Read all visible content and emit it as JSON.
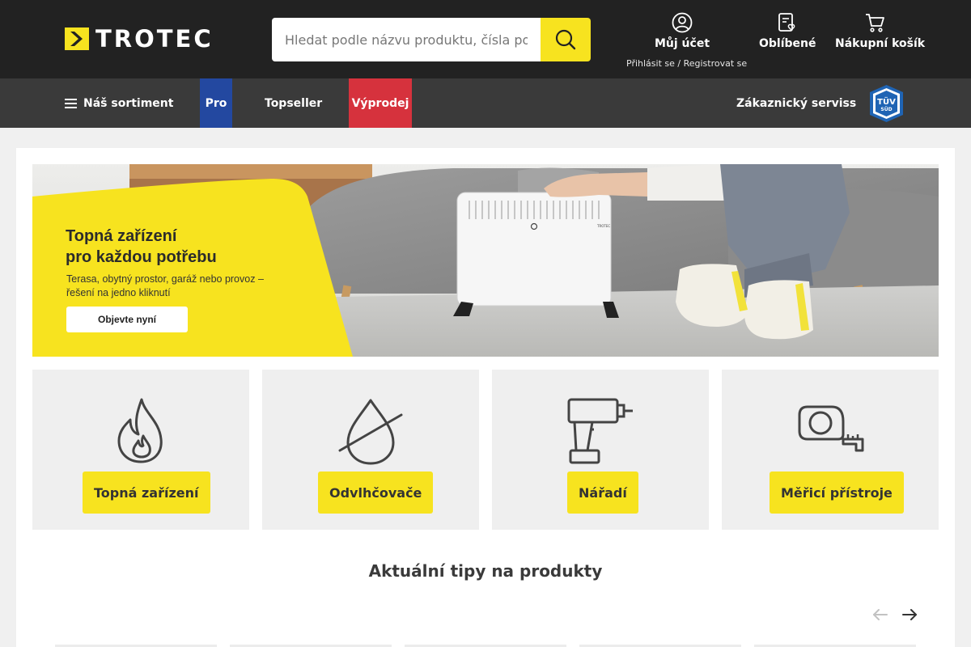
{
  "header": {
    "logo_text": "TROTEC",
    "search_placeholder": "Hledat podle názvu produktu, čísla položky",
    "account_label": "Můj účet",
    "account_sub": "Přihlásit se / Registrovat se",
    "favorites_label": "Oblíbené",
    "cart_label": "Nákupní košík"
  },
  "nav": {
    "assortment": "Náš sortiment",
    "pro": "Pro",
    "topseller": "Topseller",
    "sale": "Výprodej",
    "service": "Zákaznický serviss",
    "tuv_text": "TÜV",
    "tuv_sub": "SÜD",
    "colors": {
      "pro": "#2348a0",
      "sale": "#d6323d"
    }
  },
  "banner": {
    "title_line1": "Topná zařízení",
    "title_line2": "pro každou potřebu",
    "subtitle_line1": "Terasa, obytný prostor, garáž nebo provoz –",
    "subtitle_line2": "řešení na jedno kliknutí",
    "button": "Objevte nyní",
    "heater_brand": "TROTEC"
  },
  "categories": [
    {
      "label": "Topná zařízení",
      "icon": "flame-icon"
    },
    {
      "label": "Odvlhčovače",
      "icon": "drop-crossed-icon"
    },
    {
      "label": "Nářadí",
      "icon": "drill-icon"
    },
    {
      "label": "Měřicí přístroje",
      "icon": "tape-measure-icon"
    }
  ],
  "tips": {
    "title": "Aktuální tipy na produkty"
  },
  "colors": {
    "accent": "#f7e31f",
    "header_bg": "#222222",
    "nav_bg": "#3a3a3a"
  }
}
